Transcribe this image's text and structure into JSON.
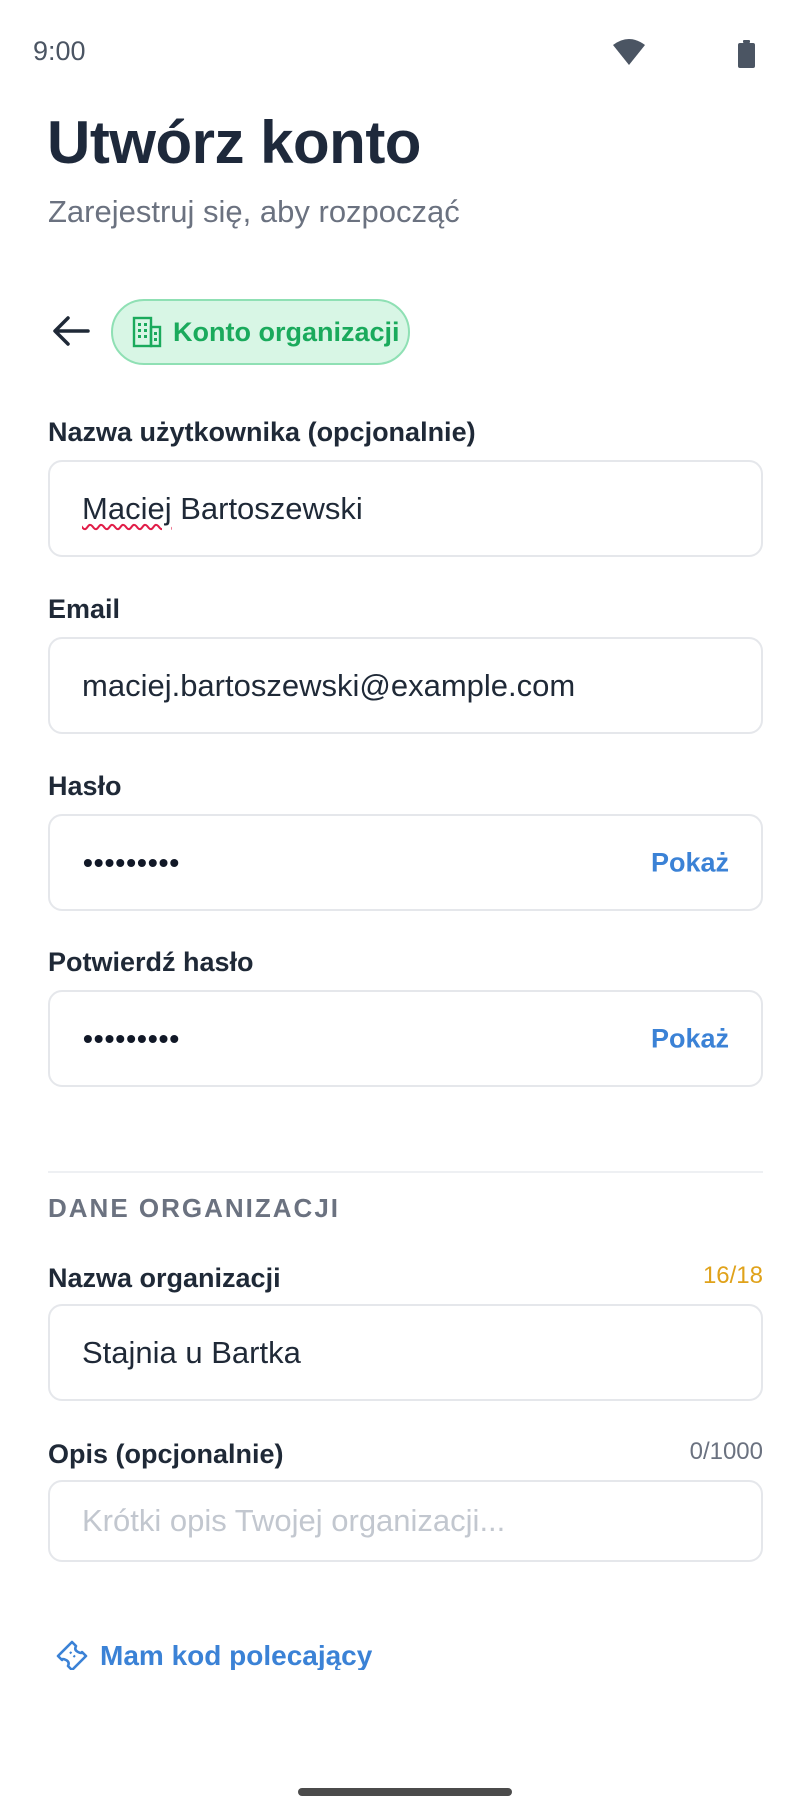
{
  "status_bar": {
    "time": "9:00",
    "wifi_icon": "wifi-icon",
    "battery_icon": "battery-icon"
  },
  "header": {
    "title": "Utwórz konto",
    "subtitle": "Zarejestruj się, aby rozpocząć"
  },
  "account_type": {
    "back_icon": "arrow-left-icon",
    "chip_icon": "building-icon",
    "chip_label": "Konto organizacji",
    "accent_color": "#1aaa5c"
  },
  "form": {
    "username": {
      "label": "Nazwa użytkownika (opcjonalnie)",
      "value_first": "Maciej",
      "value_rest": " Bartoszewski"
    },
    "email": {
      "label": "Email",
      "value": "maciej.bartoszewski@example.com"
    },
    "password": {
      "label": "Hasło",
      "masked_value": "•••••••••",
      "toggle_label": "Pokaż"
    },
    "confirm_password": {
      "label": "Potwierdź hasło",
      "masked_value": "•••••••••",
      "toggle_label": "Pokaż"
    }
  },
  "organization": {
    "section_title": "DANE ORGANIZACJI",
    "name": {
      "label": "Nazwa organizacji",
      "value": "Stajnia u Bartka",
      "counter": "16/18"
    },
    "description": {
      "label": "Opis (opcjonalnie)",
      "placeholder": "Krótki opis Twojej organizacji...",
      "counter": "0/1000"
    }
  },
  "referral": {
    "icon": "ticket-icon",
    "label": "Mam kod polecający"
  },
  "colors": {
    "link": "#3b82d6",
    "counter_warning": "#e0a21a"
  }
}
